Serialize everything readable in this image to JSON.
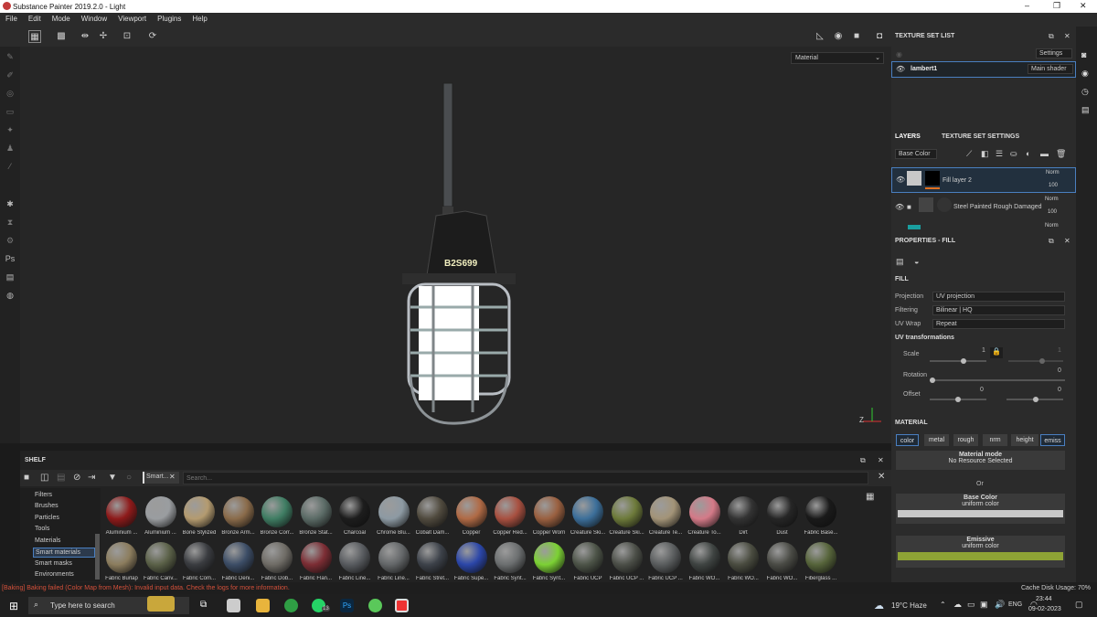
{
  "window": {
    "title": "Substance Painter 2019.2.0 - Light",
    "min": "–",
    "max": "❐",
    "close": "✕"
  },
  "menu": [
    "File",
    "Edit",
    "Mode",
    "Window",
    "Viewport",
    "Plugins",
    "Help"
  ],
  "viewport": {
    "material_mode": "Material",
    "lamp_label": "B2S699",
    "axis": "Z"
  },
  "shelf": {
    "title": "SHELF",
    "search_placeholder": "Search...",
    "filter_chip": "Smart...",
    "categories": [
      "Filters",
      "Brushes",
      "Particles",
      "Tools",
      "Materials",
      "Smart materials",
      "Smart masks",
      "Environments"
    ],
    "selected_category": "Smart materials",
    "row1": [
      "Aluminium ...",
      "Aluminium ...",
      "Bone Stylized",
      "Bronze Arm...",
      "Bronze Corr...",
      "Bronze Stat...",
      "Charcoal",
      "Chrome Blu...",
      "Cobalt Dam...",
      "Copper",
      "Copper Red...",
      "Copper Worn",
      "Creature Ski...",
      "Creature Ski...",
      "Creature Te...",
      "Creature To...",
      "Dirt",
      "Dust",
      "Fabric Base..."
    ],
    "row2": [
      "Fabric Burlap",
      "Fabric Canv...",
      "Fabric Com...",
      "Fabric Deni...",
      "Fabric Dob...",
      "Fabric Flan...",
      "Fabric Line...",
      "Fabric Line...",
      "Fabric Stret...",
      "Fabric Supe...",
      "Fabric Synt...",
      "Fabric Synt...",
      "Fabric UCP",
      "Fabric UCP ...",
      "Fabric UCP ...",
      "Fabric WO...",
      "Fabric WO...",
      "Fabric WO...",
      "Fiberglass ..."
    ]
  },
  "texture_set": {
    "title": "TEXTURE SET LIST",
    "settings": "Settings",
    "item": "lambert1",
    "shader": "Main shader"
  },
  "layers": {
    "tab1": "LAYERS",
    "tab2": "TEXTURE SET SETTINGS",
    "channel": "Base Color",
    "items": [
      {
        "name": "Fill layer 2",
        "blend": "Norm",
        "opacity": "100"
      },
      {
        "name": "Steel Painted Rough Damaged",
        "blend": "Norm",
        "opacity": "100"
      },
      {
        "name": "",
        "blend": "Norm",
        "opacity": ""
      }
    ]
  },
  "properties": {
    "title": "PROPERTIES - FILL",
    "section": "FILL",
    "projection_label": "Projection",
    "projection": "UV projection",
    "filtering_label": "Filtering",
    "filtering": "Bilinear | HQ",
    "uvwrap_label": "UV Wrap",
    "uvwrap": "Repeat",
    "uvt": "UV transformations",
    "scale_label": "Scale",
    "scale_value": "1",
    "scale_value2": "1",
    "rotation_label": "Rotation",
    "rotation_value": "0",
    "offset_label": "Offset",
    "offset_x": "0",
    "offset_y": "0",
    "material_title": "MATERIAL",
    "channels": [
      "color",
      "metal",
      "rough",
      "nrm",
      "height",
      "emiss"
    ],
    "material_mode": "Material mode",
    "no_resource": "No Resource Selected",
    "or": "Or",
    "base_color": "Base Color",
    "base_uniform": "uniform color",
    "emissive": "Emissive",
    "emissive_uniform": "uniform color",
    "colors": {
      "base": "#c8c8c8",
      "emissive": "#8ea335"
    }
  },
  "status": {
    "error": "[Baking] Baking failed (Color Map from Mesh): Invalid input data. Check the logs for more information.",
    "cache": "Cache Disk Usage:",
    "cache_value": "70%"
  },
  "taskbar": {
    "search": "Type here to search",
    "weather": "19°C  Haze",
    "lang": "ENG",
    "time": "23:44",
    "date": "09-02-2023",
    "badge": "13"
  }
}
